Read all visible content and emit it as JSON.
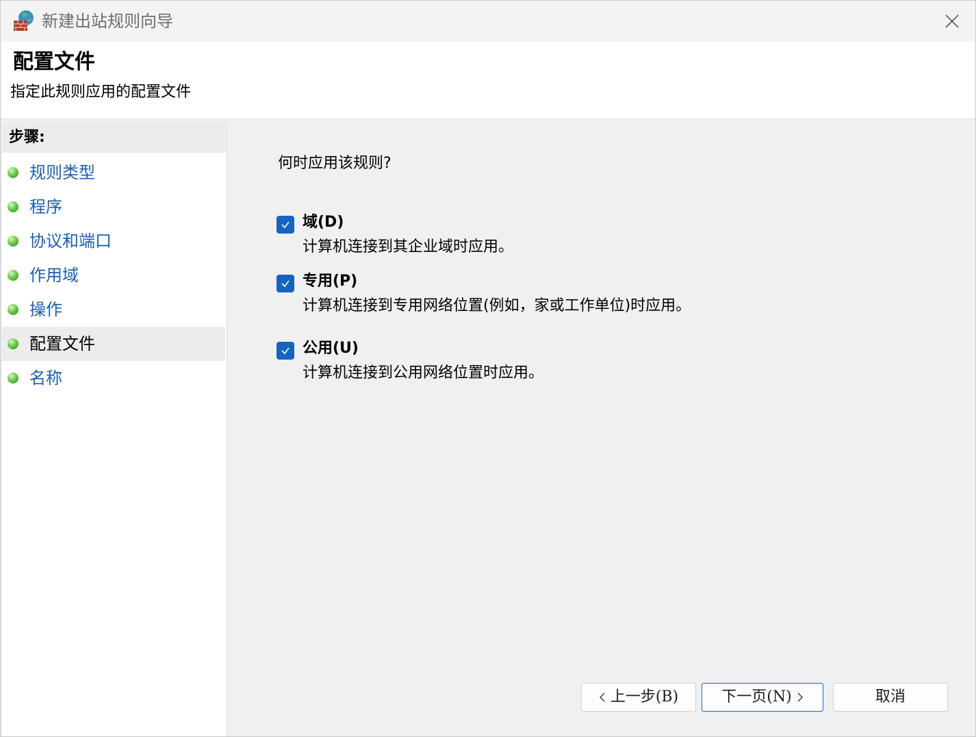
{
  "window": {
    "title": "新建出站规则向导",
    "icons": {
      "app": "firewall-wall-icon",
      "close": "close-icon"
    }
  },
  "header": {
    "title": "配置文件",
    "subtitle": "指定此规则应用的配置文件"
  },
  "steps": {
    "heading": "步骤:",
    "items": [
      {
        "label": "规则类型",
        "active": false
      },
      {
        "label": "程序",
        "active": false
      },
      {
        "label": "协议和端口",
        "active": false
      },
      {
        "label": "作用域",
        "active": false
      },
      {
        "label": "操作",
        "active": false
      },
      {
        "label": "配置文件",
        "active": true
      },
      {
        "label": "名称",
        "active": false
      }
    ],
    "bullet_color": "#3aa51e"
  },
  "main": {
    "question": "何时应用该规则?",
    "options": [
      {
        "title": "域(D)",
        "description": "计算机连接到其企业域时应用。",
        "checked": true
      },
      {
        "title": "专用(P)",
        "description": "计算机连接到专用网络位置(例如，家或工作单位)时应用。",
        "checked": true
      },
      {
        "title": "公用(U)",
        "description": "计算机连接到公用网络位置时应用。",
        "checked": true
      }
    ]
  },
  "buttons": {
    "back_label": "上一步(B)",
    "next_label": "下一页(N)",
    "cancel_label": "取消"
  },
  "colors": {
    "accent": "#1564c0",
    "link": "#1a5fb4",
    "panel_bg": "#f0f0f0"
  }
}
